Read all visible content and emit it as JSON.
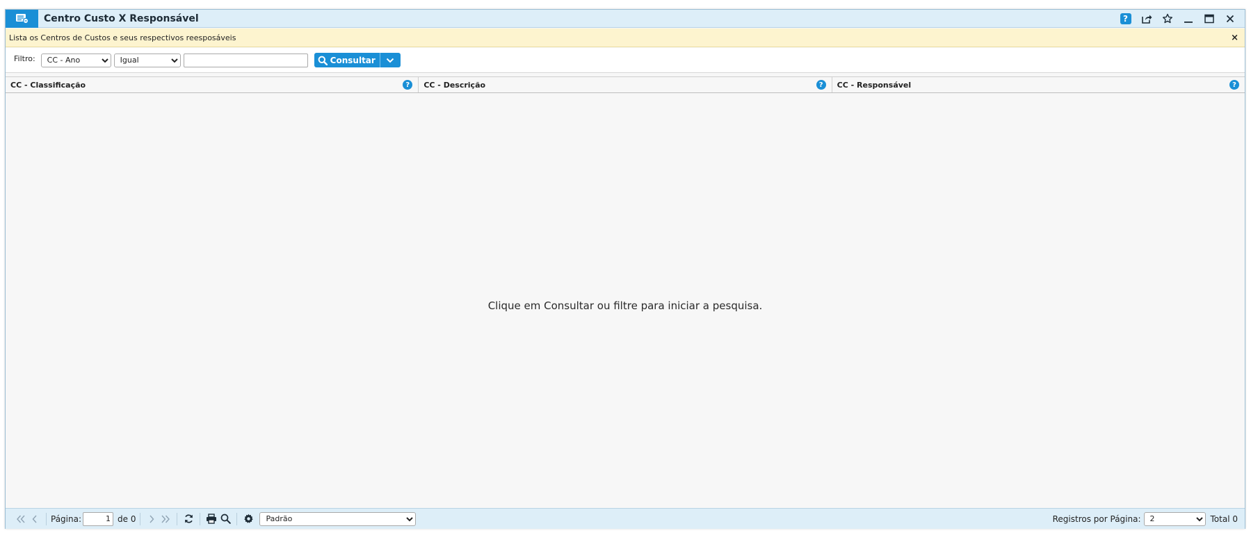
{
  "window": {
    "title": "Centro Custo X Responsável",
    "help_label": "?"
  },
  "info": {
    "message": "Lista os Centros de Custos e seus respectivos reesposáveis",
    "close_label": "×"
  },
  "filter": {
    "label": "Filtro:",
    "field_selected": "CC - Ano",
    "operator_selected": "Igual",
    "value": "",
    "consult_label": "Consultar"
  },
  "grid": {
    "columns": [
      {
        "label": "CC - Classificação",
        "help": "?"
      },
      {
        "label": "CC - Descrição",
        "help": "?"
      },
      {
        "label": "CC - Responsável",
        "help": "?"
      }
    ],
    "empty_message": "Clique em Consultar ou filtre para iniciar a pesquisa."
  },
  "footer": {
    "page_label": "Página:",
    "page_value": "1",
    "page_of": "de 0",
    "view_selected": "Padrão",
    "rows_per_page_label": "Registros por Página:",
    "rows_per_page_value": "2",
    "total_label": "Total 0"
  },
  "colors": {
    "accent": "#1a8fd6",
    "titlebar_bg": "#ddeef8",
    "info_bg": "#fdf4cf"
  }
}
